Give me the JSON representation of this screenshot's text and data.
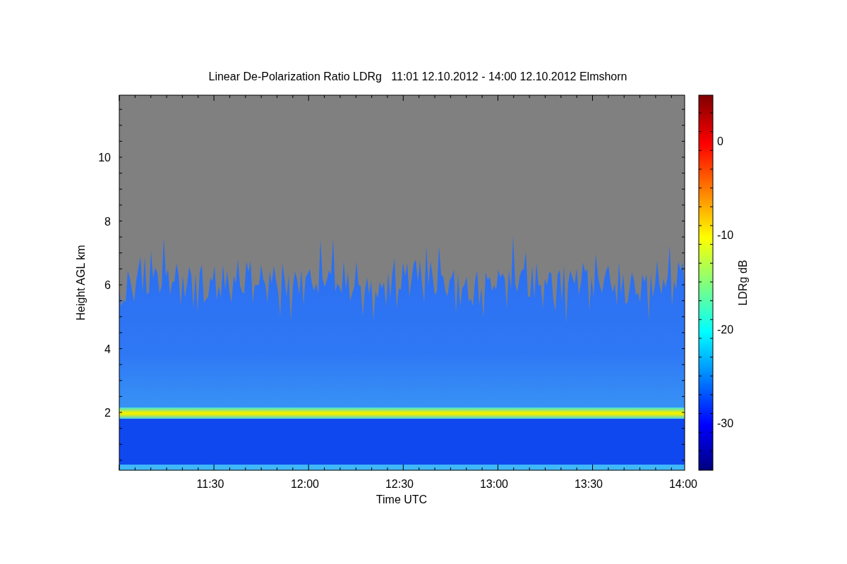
{
  "title": "Linear De-Polarization Ratio LDRg   11:01 12.10.2012 - 14:00 12.10.2012 Elmshorn",
  "y_axis": {
    "label": "Height AGL km",
    "ticks": [
      "10",
      "8",
      "6",
      "4",
      "2"
    ]
  },
  "x_axis": {
    "label": "Time UTC",
    "ticks": [
      "11:30",
      "12:00",
      "12:30",
      "13:00",
      "13:30",
      "14:00"
    ]
  },
  "colorbar": {
    "label": "LDRg dB",
    "ticks": [
      "0",
      "-10",
      "-20",
      "-30"
    ]
  }
}
